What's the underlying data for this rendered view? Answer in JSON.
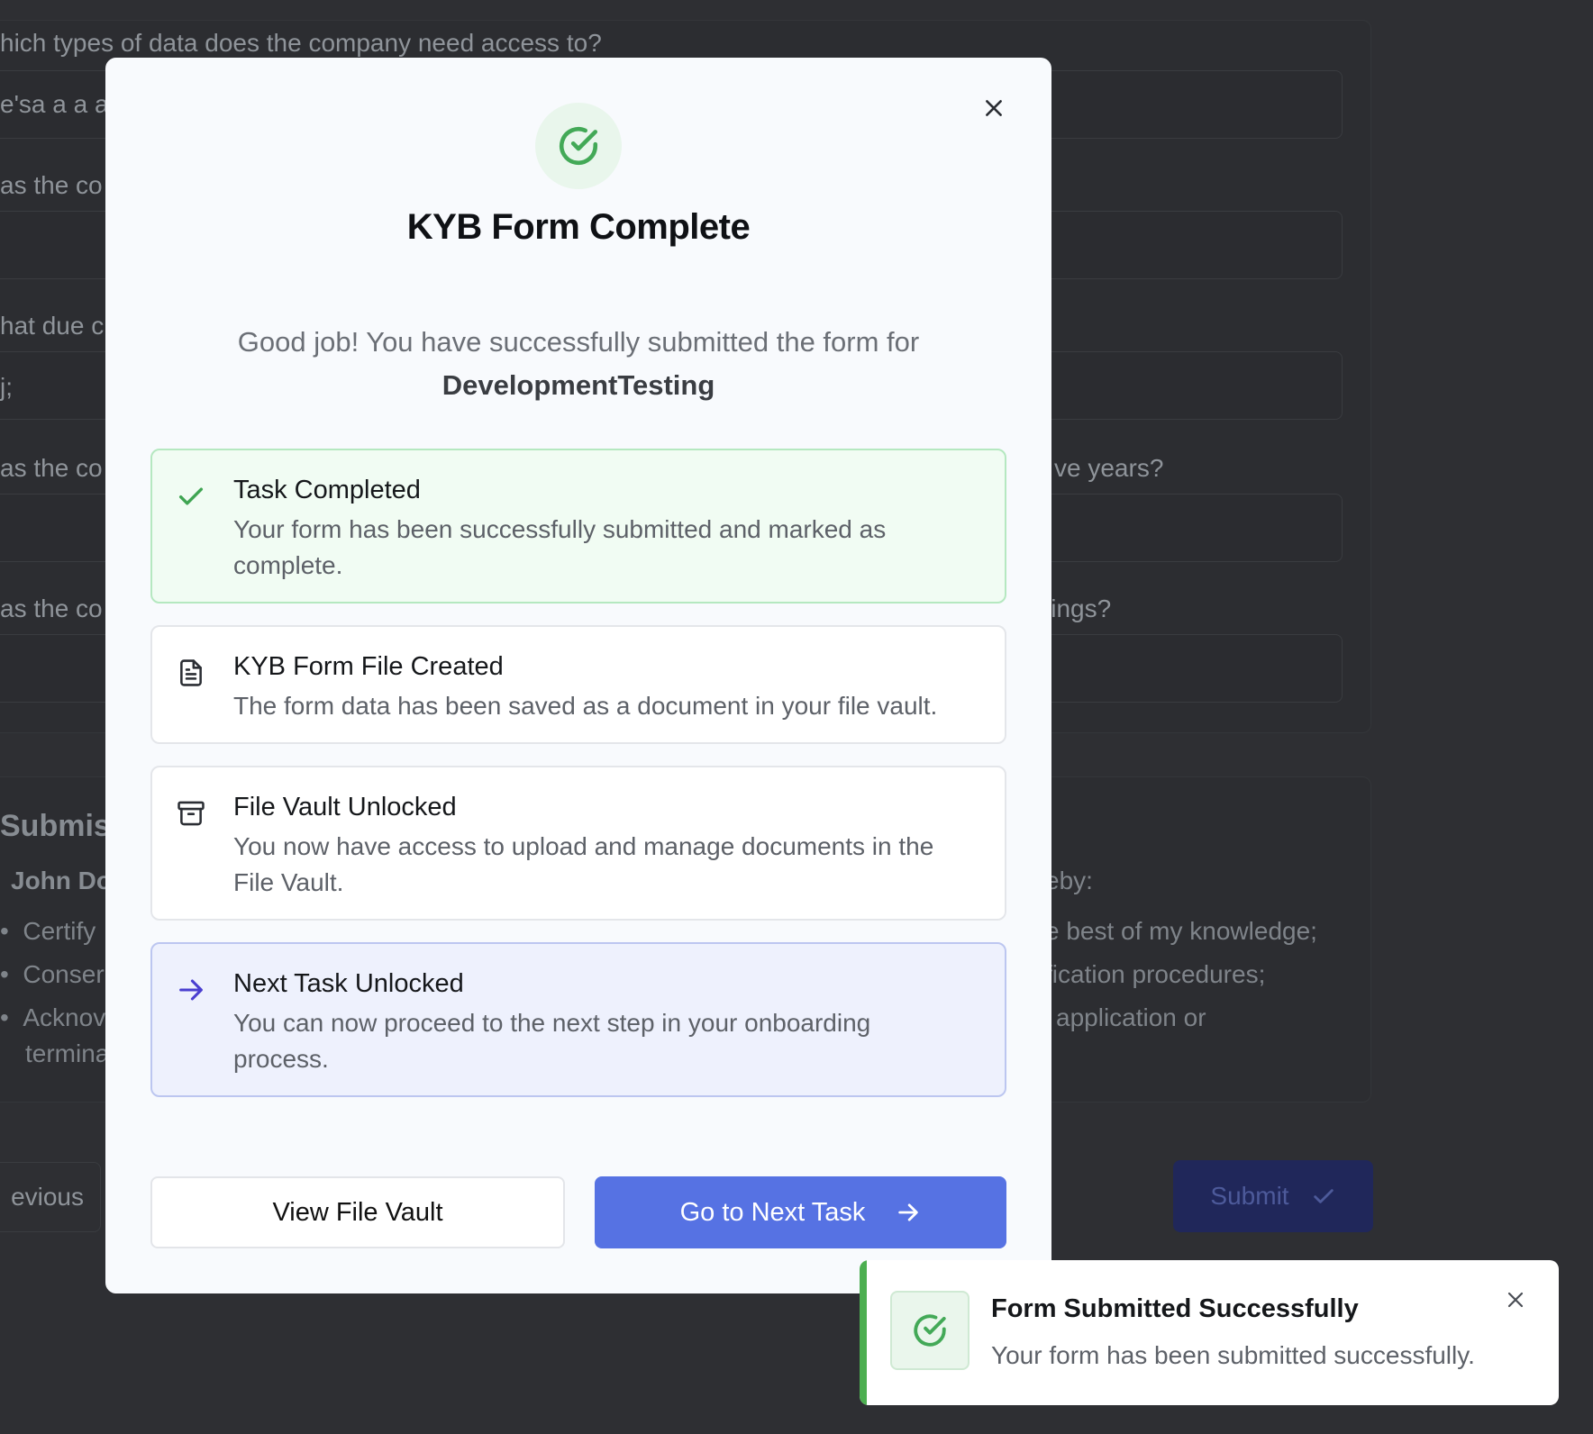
{
  "background": {
    "questions": [
      "hich types of data does the company need access to?",
      "as the co",
      "hat due c",
      "as the co",
      "as the co"
    ],
    "questions_right": [
      "",
      "",
      "",
      "ve years?",
      "lings?"
    ],
    "answers": [
      "e'sa a a a",
      "",
      "j;",
      "",
      ""
    ],
    "submission_heading": "Submiss",
    "signer_left": "John Do",
    "signer_right": "eby:",
    "list_left": [
      "Certify",
      "Conser",
      "Acknov",
      "termina"
    ],
    "list_right": [
      "e best of my knowledge;",
      "fication procedures;",
      "application or",
      ""
    ],
    "previous_label": "evious",
    "submit_label": "Submit"
  },
  "modal": {
    "title": "KYB Form Complete",
    "description": "Good job! You have successfully submitted the form for",
    "company": "DevelopmentTesting",
    "steps": [
      {
        "icon": "check-icon",
        "title": "Task Completed",
        "body": "Your form has been successfully submitted and marked as complete."
      },
      {
        "icon": "file-text-icon",
        "title": "KYB Form File Created",
        "body": "The form data has been saved as a document in your file vault."
      },
      {
        "icon": "archive-icon",
        "title": "File Vault Unlocked",
        "body": "You now have access to upload and manage documents in the File Vault."
      },
      {
        "icon": "arrow-right-icon",
        "title": "Next Task Unlocked",
        "body": "You can now proceed to the next step in your onboarding process."
      }
    ],
    "view_vault_label": "View File Vault",
    "next_task_label": "Go to Next Task"
  },
  "toast": {
    "title": "Form Submitted Successfully",
    "message": "Your form has been submitted successfully."
  },
  "colors": {
    "success": "#4caf50",
    "primary": "#5672e3",
    "overlay": "#2e2f33"
  }
}
